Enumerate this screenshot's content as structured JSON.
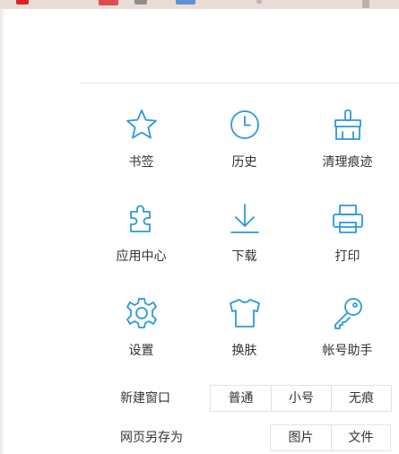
{
  "browser": {
    "tab_badge": "ON"
  },
  "menu": {
    "tiles": [
      {
        "label": "书签",
        "icon": "star-icon"
      },
      {
        "label": "历史",
        "icon": "clock-icon"
      },
      {
        "label": "清理痕迹",
        "icon": "broom-icon"
      },
      {
        "label": "应用中心",
        "icon": "puzzle-icon"
      },
      {
        "label": "下载",
        "icon": "download-icon"
      },
      {
        "label": "打印",
        "icon": "printer-icon"
      },
      {
        "label": "设置",
        "icon": "gear-icon"
      },
      {
        "label": "换肤",
        "icon": "shirt-icon"
      },
      {
        "label": "帐号助手",
        "icon": "key-icon"
      }
    ],
    "new_window": {
      "label": "新建窗口",
      "options": [
        "普通",
        "小号",
        "无痕"
      ]
    },
    "save_page": {
      "label": "网页另存为",
      "options": [
        "图片",
        "文件"
      ]
    }
  },
  "colors": {
    "icon_accent": "#2b9ad7",
    "text": "#333333",
    "border": "#e2e2e2"
  }
}
